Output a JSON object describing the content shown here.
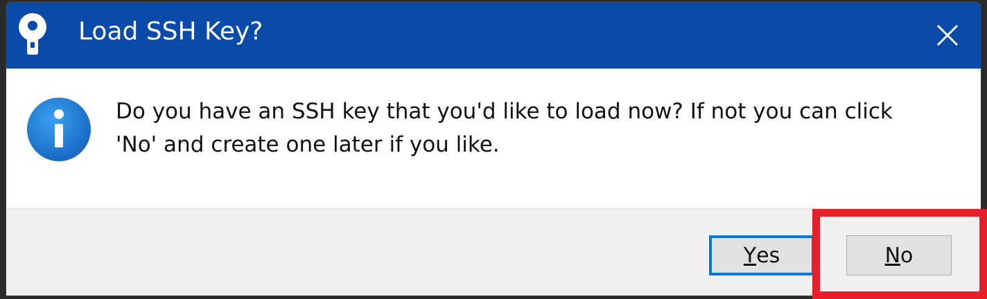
{
  "window": {
    "title": "Load SSH Key?",
    "app_icon": "putty-pageant-key-icon",
    "close_icon": "close-icon"
  },
  "message": {
    "icon": "info-icon",
    "line1": "Do you have an SSH key that you'd like to load now? If not you can click",
    "line2": "'No' and create one later if you like."
  },
  "buttons": {
    "yes": {
      "mnemonic": "Y",
      "rest": "es"
    },
    "no": {
      "mnemonic": "N",
      "rest": "o"
    }
  },
  "colors": {
    "titlebar": "#0a4aa8",
    "focus_outline": "#0078d7",
    "highlight": "#e81f2a",
    "info_icon": "#1976d2"
  }
}
